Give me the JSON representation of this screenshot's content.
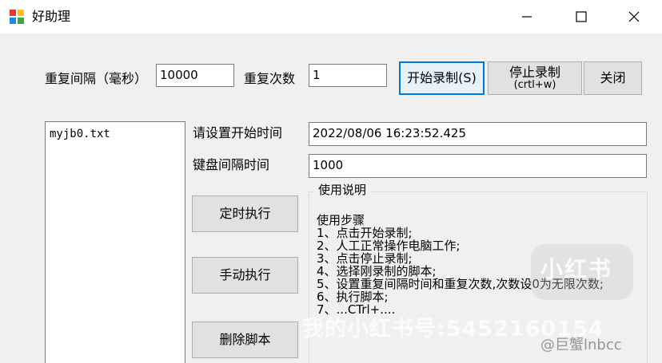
{
  "window": {
    "title": "好助理"
  },
  "controls": {
    "interval_label": "重复间隔（毫秒）",
    "interval_value": "10000",
    "count_label": "重复次数",
    "count_value": "1",
    "start_record": "开始录制(S)",
    "stop_record_line1": "停止录制",
    "stop_record_line2": "(crtl+w)",
    "close": "关闭"
  },
  "scripts": {
    "items": [
      "myjb0.txt"
    ]
  },
  "settings": {
    "start_time_label": "请设置开始时间",
    "start_time_value": "2022/08/06 16:23:52.425",
    "key_interval_label": "键盘间隔时间",
    "key_interval_value": "1000"
  },
  "actions": {
    "scheduled_run": "定时执行",
    "manual_run": "手动执行",
    "delete_script": "删除脚本"
  },
  "instructions": {
    "title": "使用说明",
    "lines": [
      "使用步骤",
      "1、点击开始录制;",
      "2、人工正常操作电脑工作;",
      "3、点击停止录制;",
      "4、选择刚录制的脚本;",
      "5、设置重复间隔时间和重复次数,次数设0为无限次数;",
      "6、执行脚本;",
      "7、...CTrl+...."
    ]
  },
  "watermarks": {
    "badge": "小红书",
    "main": "我的小红书号:5452160154",
    "credit": "@巨蟹lnbcc"
  },
  "icons": {
    "app": "app-logo-icon",
    "minimize": "minimize-icon",
    "maximize": "maximize-icon",
    "close": "close-icon"
  }
}
